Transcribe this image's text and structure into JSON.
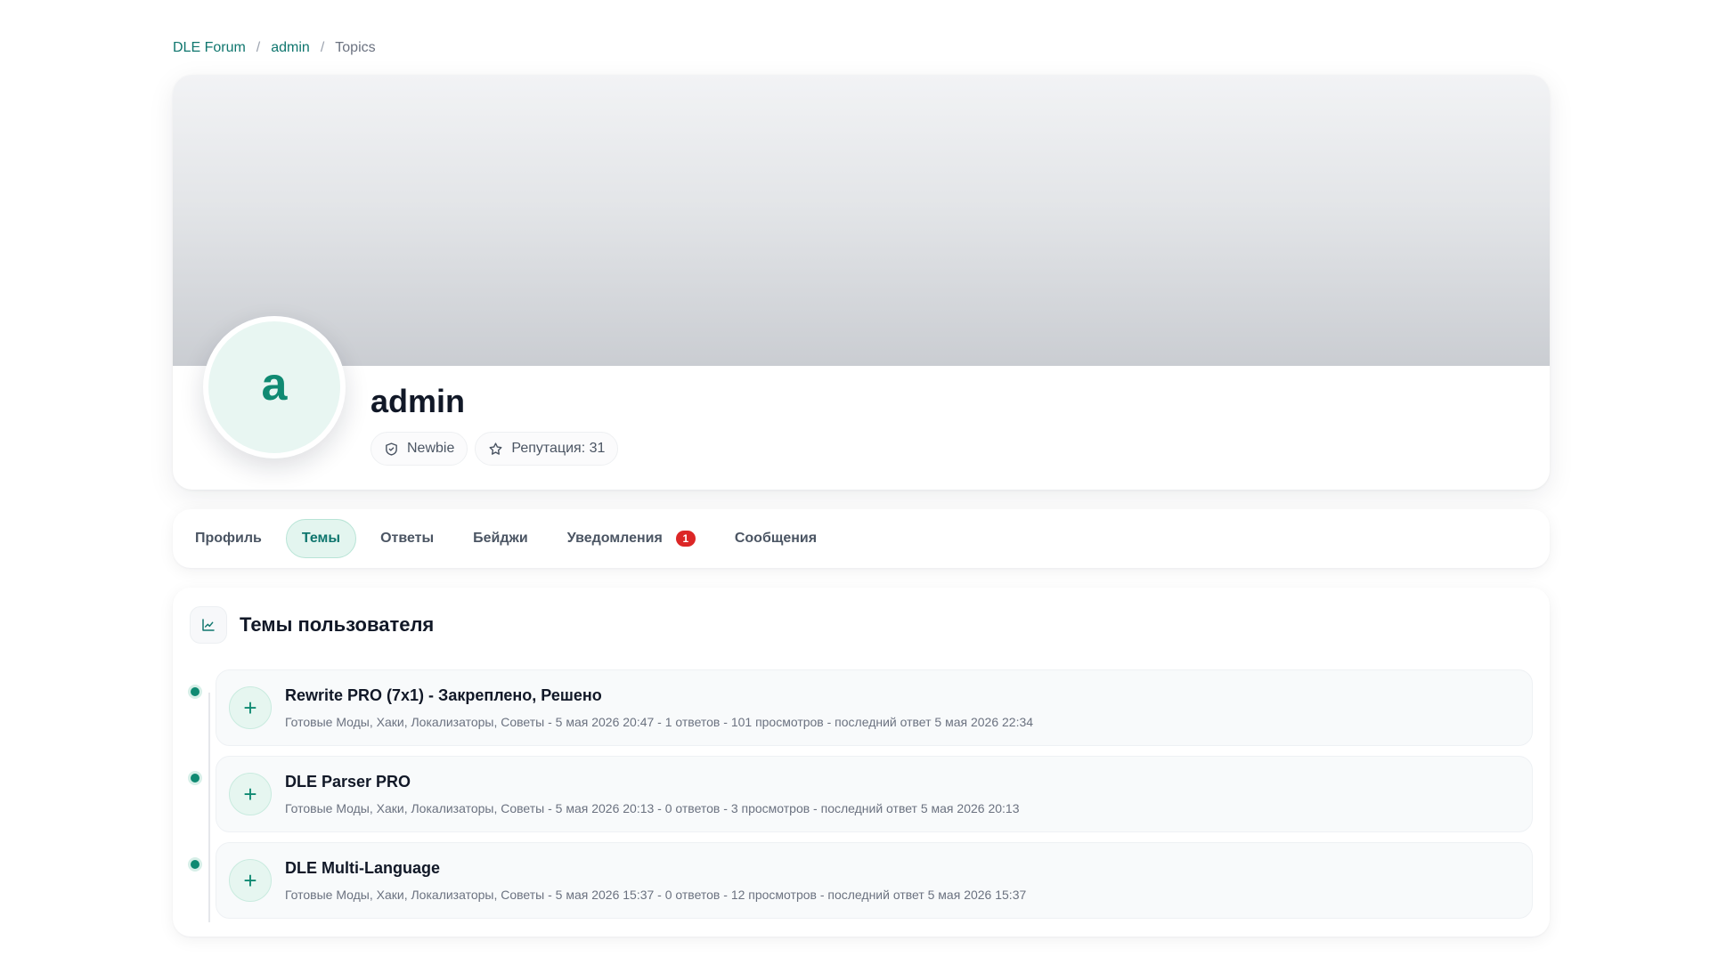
{
  "breadcrumb": {
    "items": [
      "DLE Forum",
      "admin",
      "Topics"
    ],
    "separator": "/"
  },
  "profile": {
    "avatar_letter": "a",
    "username": "admin",
    "rank": "Newbie",
    "reputation": "Репутация: 31"
  },
  "tabs": [
    {
      "label": "Профиль",
      "active": false
    },
    {
      "label": "Темы",
      "active": true
    },
    {
      "label": "Ответы",
      "active": false
    },
    {
      "label": "Бейджи",
      "active": false
    },
    {
      "label": "Уведомления",
      "active": false,
      "badge": "1"
    },
    {
      "label": "Сообщения",
      "active": false
    }
  ],
  "section": {
    "title": "Темы пользователя",
    "icon": "chart-line-icon"
  },
  "topics": [
    {
      "title": "Rewrite PRO (7x1) - Закреплено, Решено",
      "meta": "Готовые Моды, Хаки, Локализаторы, Советы - 5 мая 2026 20:47 - 1 ответов - 101 просмотров - последний ответ 5 мая 2026 22:34",
      "icon": "plus-icon"
    },
    {
      "title": "DLE Parser PRO",
      "meta": "Готовые Моды, Хаки, Локализаторы, Советы - 5 мая 2026 20:13 - 0 ответов - 3 просмотров - последний ответ 5 мая 2026 20:13",
      "icon": "plus-icon"
    },
    {
      "title": "DLE Multi-Language",
      "meta": "Готовые Моды, Хаки, Локализаторы, Советы - 5 мая 2026 15:37 - 0 ответов - 12 просмотров - последний ответ 5 мая 2026 15:37",
      "icon": "plus-icon"
    }
  ],
  "colors": {
    "accent": "#0f8a72",
    "badge": "#dc2626"
  }
}
